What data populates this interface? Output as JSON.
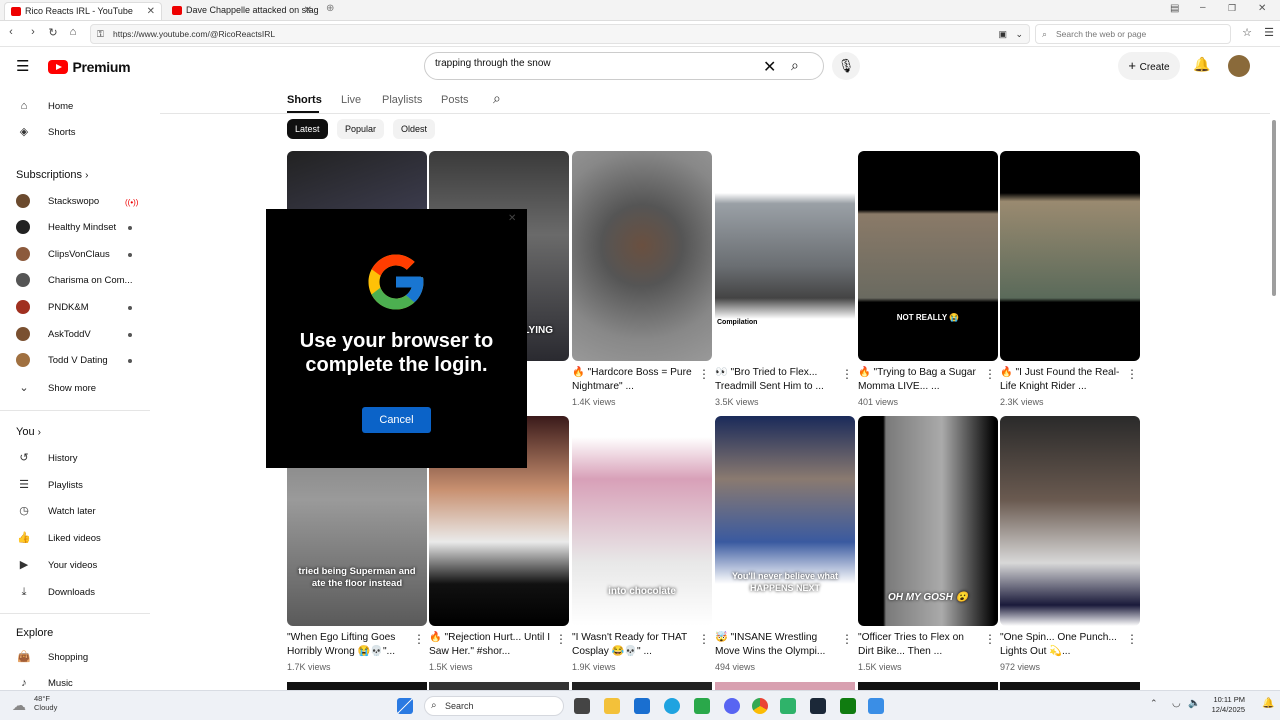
{
  "browser": {
    "tabs": [
      {
        "title": "Rico Reacts IRL - YouTube"
      },
      {
        "title": "Dave Chappelle attacked on stage"
      }
    ],
    "url": "https://www.youtube.com/@RicoReactsIRL",
    "web_search_placeholder": "Search the web or page"
  },
  "youtube": {
    "logo_text": "Premium",
    "search_value": "trapping through the snow",
    "create_label": "Create"
  },
  "sidebar": {
    "home": "Home",
    "shorts": "Shorts",
    "subscriptions_header": "Subscriptions",
    "subscriptions": [
      {
        "name": "Stackswopo",
        "color": "#6b4a2e"
      },
      {
        "name": "Healthy Mindset",
        "color": "#222222"
      },
      {
        "name": "ClipsVonClaus",
        "color": "#8c5a3c"
      },
      {
        "name": "Charisma on Com...",
        "color": "#555555"
      },
      {
        "name": "PNDK&M",
        "color": "#a03020"
      },
      {
        "name": "AskToddV",
        "color": "#7a5030"
      },
      {
        "name": "Todd V Dating",
        "color": "#a07040"
      }
    ],
    "show_more": "Show more",
    "you_header": "You",
    "you_items": [
      "History",
      "Playlists",
      "Watch later",
      "Liked videos",
      "Your videos",
      "Downloads"
    ],
    "explore_header": "Explore",
    "explore_items": [
      "Shopping",
      "Music"
    ]
  },
  "channel": {
    "tabs": [
      "Shorts",
      "Live",
      "Playlists",
      "Posts"
    ],
    "chips": [
      "Latest",
      "Popular",
      "Oldest"
    ]
  },
  "shorts": [
    {
      "title": "",
      "views": "",
      "caption": ""
    },
    {
      "title": "",
      "views": "",
      "caption": "FLYING"
    },
    {
      "title": "🔥 \"Hardcore Boss = Pure Nightmare\" ...",
      "views": "1.4K views",
      "caption": ""
    },
    {
      "title": "👀 \"Bro Tried to Flex... Treadmill Sent Him to ...",
      "views": "3.5K views",
      "caption": "Compilation"
    },
    {
      "title": "🔥 \"Trying to Bag a Sugar Momma LIVE... ...",
      "views": "401 views",
      "caption": "NOT REALLY 😭"
    },
    {
      "title": "🔥 \"I Just Found the Real-Life Knight Rider ...",
      "views": "2.3K views",
      "caption": ""
    },
    {
      "title": "\"When Ego Lifting Goes Horribly Wrong 😭💀\"...",
      "views": "1.7K views",
      "caption": "tried being Superman and ate the floor instead"
    },
    {
      "title": "🔥 \"Rejection Hurt... Until I Saw Her.\" #shor...",
      "views": "1.5K views",
      "caption": ""
    },
    {
      "title": "\"I Wasn't Ready for THAT Cosplay 😂💀\" ...",
      "views": "1.9K views",
      "caption": "into chocolate"
    },
    {
      "title": "🤯 \"INSANE Wrestling Move Wins the Olympi...",
      "views": "494 views",
      "caption": "You'll never believe what HAPPENS NEXT"
    },
    {
      "title": "\"Officer Tries to Flex on Dirt Bike... Then ...",
      "views": "1.5K views",
      "caption": "OH MY GOSH 😮"
    },
    {
      "title": "\"One Spin... One Punch... Lights Out 💫...",
      "views": "972 views",
      "caption": ""
    }
  ],
  "dialog": {
    "message": "Use your browser to complete the login.",
    "cancel_label": "Cancel"
  },
  "taskbar": {
    "temp": "48°F",
    "condition": "Cloudy",
    "search_label": "Search",
    "time": "10:11 PM",
    "date": "12/4/2025"
  }
}
